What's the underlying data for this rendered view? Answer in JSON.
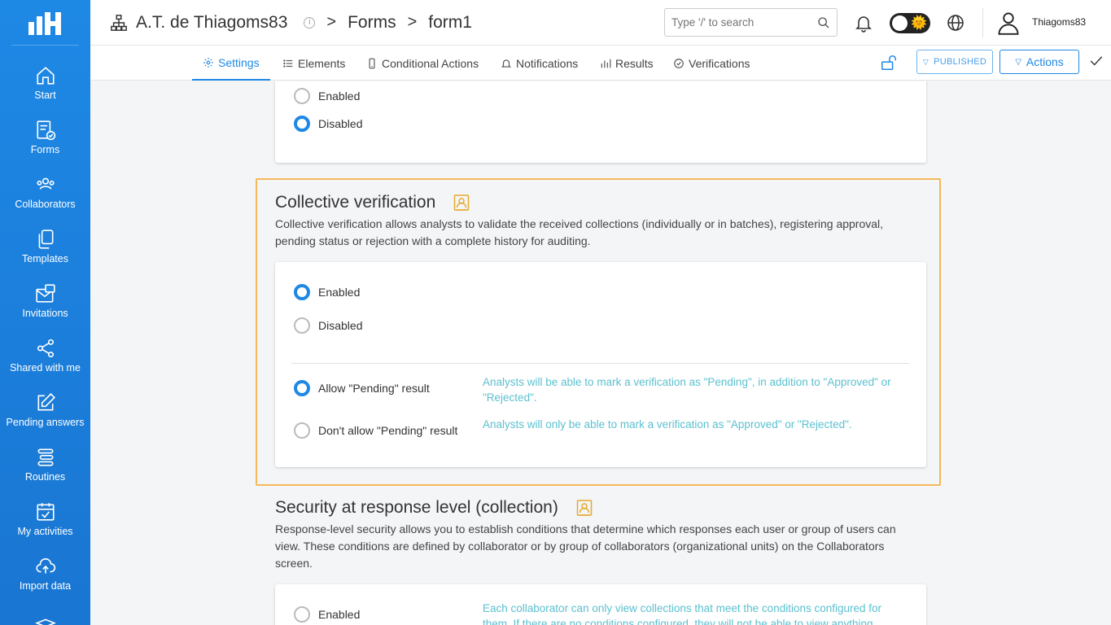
{
  "sidebar": {
    "items": [
      {
        "label": "Start",
        "icon": "home-icon"
      },
      {
        "label": "Forms",
        "icon": "form-check-icon"
      },
      {
        "label": "Collaborators",
        "icon": "users-icon"
      },
      {
        "label": "Templates",
        "icon": "copy-icon"
      },
      {
        "label": "Invitations",
        "icon": "envelope-icon"
      },
      {
        "label": "Shared with me",
        "icon": "share-icon"
      },
      {
        "label": "Pending answers",
        "icon": "edit-icon"
      },
      {
        "label": "Routines",
        "icon": "list-icon"
      },
      {
        "label": "My activities",
        "icon": "calendar-check-icon"
      },
      {
        "label": "Import data",
        "icon": "cloud-upload-icon"
      }
    ]
  },
  "header": {
    "org": "A.T. de Thiagoms83",
    "info": "i",
    "sep": ">",
    "crumb_forms": "Forms",
    "crumb_form": "form1",
    "search_placeholder": "Type '/' to search",
    "username": "Thiagoms83"
  },
  "tabs": {
    "settings": "Settings",
    "elements": "Elements",
    "conditional": "Conditional Actions",
    "notifications": "Notifications",
    "results": "Results",
    "verifications": "Verifications",
    "published": "PUBLISHED",
    "actions": "Actions"
  },
  "top_card": {
    "enabled": "Enabled",
    "disabled": "Disabled",
    "selected": "disabled"
  },
  "collective": {
    "title": "Collective verification",
    "desc": "Collective verification allows analysts to validate the received collections (individually or in batches), registering approval, pending status or rejection with a complete history for auditing.",
    "enabled": "Enabled",
    "disabled": "Disabled",
    "allow_pending": "Allow \"Pending\" result",
    "allow_pending_hint": "Analysts will be able to mark a verification as \"Pending\", in addition to \"Approved\" or \"Rejected\".",
    "deny_pending": "Don't allow \"Pending\" result",
    "deny_pending_hint": "Analysts will only be able to mark a verification as \"Approved\" or \"Rejected\"."
  },
  "security": {
    "title": "Security at response level (collection)",
    "desc": "Response-level security allows you to establish conditions that determine which responses each user or group of users can view. These conditions are defined by collaborator or by group of collaborators (organizational units) on the Collaborators screen.",
    "enabled": "Enabled",
    "enabled_hint": "Each collaborator can only view collections that meet the conditions configured for them. If there are no conditions configured, they will not be able to view anything."
  },
  "colors": {
    "primary": "#1e88e5",
    "highlight": "#f5b85a",
    "hint": "#5bc0cf"
  }
}
